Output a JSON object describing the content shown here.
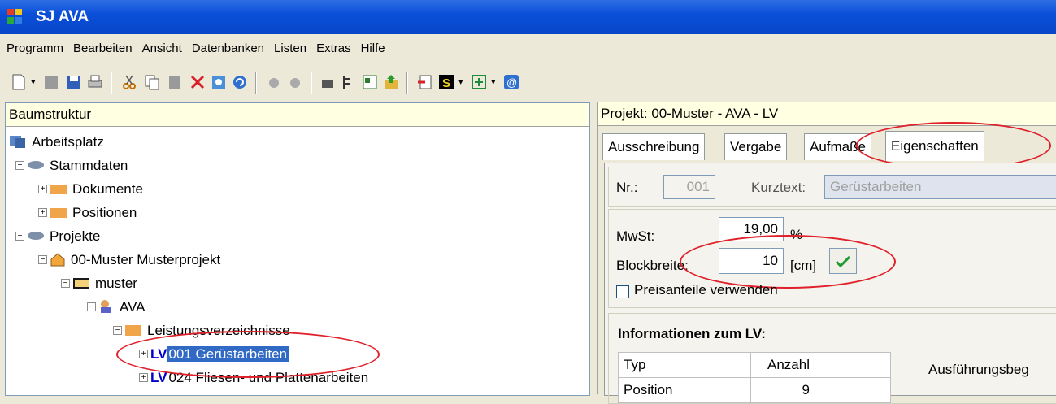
{
  "window": {
    "title": "SJ AVA"
  },
  "menu": [
    "Programm",
    "Bearbeiten",
    "Ansicht",
    "Datenbanken",
    "Listen",
    "Extras",
    "Hilfe"
  ],
  "left_panel": {
    "header": "Baumstruktur",
    "tree": [
      {
        "label": "Arbeitsplatz"
      },
      {
        "label": "Stammdaten"
      },
      {
        "label": "Dokumente"
      },
      {
        "label": "Positionen"
      },
      {
        "label": "Projekte"
      },
      {
        "label": "00-Muster Musterprojekt"
      },
      {
        "label": "muster"
      },
      {
        "label": "AVA"
      },
      {
        "label": "Leistungsverzeichnisse"
      },
      {
        "tag": "LV",
        "label": "001 Gerüstarbeiten"
      },
      {
        "tag": "LV",
        "label": "024 Fliesen- und Plattenarbeiten"
      }
    ]
  },
  "right_panel": {
    "header": "Projekt: 00-Muster - AVA - LV",
    "tabs": [
      "Ausschreibung",
      "Vergabe",
      "Aufmaße",
      "Eigenschaften"
    ],
    "nr_label": "Nr.:",
    "nr_value": "001",
    "kurztext_label": "Kurztext:",
    "kurztext_value": "Gerüstarbeiten",
    "mwst_label": "MwSt:",
    "mwst_value": "19,00",
    "mwst_unit": "%",
    "block_label": "Blockbreite:",
    "block_value": "10",
    "block_unit": "[cm]",
    "preis_label": "Preisanteile verwenden",
    "info_title": "Informationen zum LV:",
    "table_headers": [
      "Typ",
      "Anzahl",
      ""
    ],
    "table_rows": [
      [
        "Position",
        "9",
        ""
      ]
    ],
    "ausfuehrung_label": "Ausführungsbeg"
  },
  "colors": {
    "selection": "#316ac5",
    "annotation": "#e0202a",
    "titlebar": "#0a4fd8"
  }
}
